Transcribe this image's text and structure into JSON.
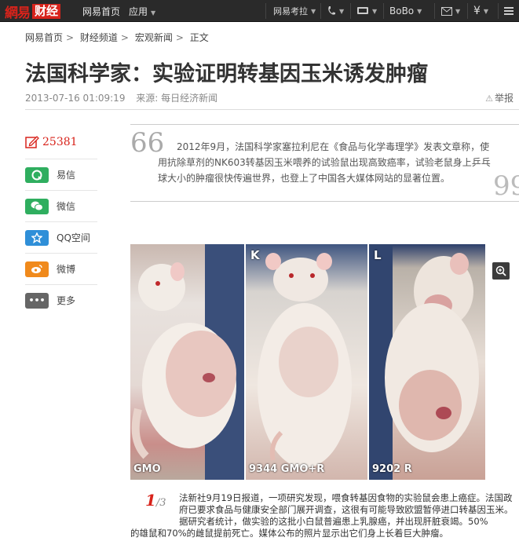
{
  "topnav": {
    "logo_net": "網易",
    "logo_section": "财经",
    "home": "网易首页",
    "apps": "应用",
    "kaowei": "网易考拉",
    "bobo": "BoBo"
  },
  "breadcrumb": [
    "网易首页",
    "财经频道",
    "宏观新闻",
    "正文"
  ],
  "article": {
    "title": "法国科学家：实验证明转基因玉米诱发肿瘤",
    "date": "2013-07-16 01:09:19",
    "source": "来源: 每日经济新闻",
    "report": "举报",
    "quote": "2012年9月，法国科学家塞拉利尼在《食品与化学毒理学》发表文章称，使用抗除草剂的NK603转基因玉米喂养的试验鼠出现高致癌率，试验老鼠身上乒乓球大小的肿瘤很快传遍世界，也登上了中国各大媒体网站的显著位置。",
    "quote_open": "66",
    "quote_close": "99",
    "page_current": "1",
    "page_total": "/3",
    "body_line1": "法新社9月19日报道，一项研究发现，喂食转基因食物的实验鼠会患上癌症。法国政府已要求食品与健康安全部门展开调查，这很有可能导致欧盟暂停进口转基因玉米。据研究者统计，做实验的这批小白鼠普遍患上乳腺癌，并出现肝脏衰竭。50%",
    "body_line2": "的雄鼠和70%的雌鼠提前死亡。媒体公布的照片显示出它们身上长着巨大肿瘤。"
  },
  "share": {
    "count": "25381",
    "items": [
      {
        "label": "易信",
        "icon": "yixin-icon",
        "color": "#2fae5f"
      },
      {
        "label": "微信",
        "icon": "wechat-icon",
        "color": "#2fae5f"
      },
      {
        "label": "QQ空间",
        "icon": "qzone-icon",
        "color": "#2f8fd8"
      },
      {
        "label": "微博",
        "icon": "weibo-icon",
        "color": "#f08a1c"
      },
      {
        "label": "更多",
        "icon": "more-icon",
        "color": "#666666"
      }
    ]
  },
  "photo": {
    "panels": [
      {
        "letter": "",
        "caption": "GMO"
      },
      {
        "letter": "K",
        "caption": "9344 GMO+R"
      },
      {
        "letter": "L",
        "caption": "9202 R"
      }
    ]
  },
  "colors": {
    "accent": "#d8231b",
    "nav_bg": "#2a2a2a"
  }
}
